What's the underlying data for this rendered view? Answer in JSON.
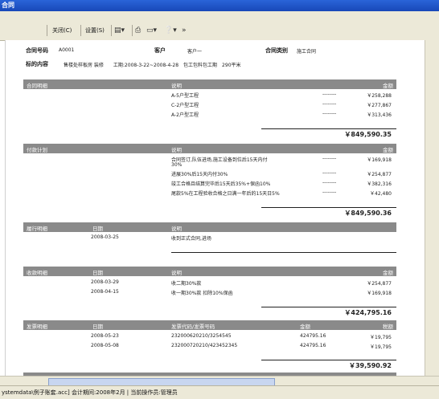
{
  "window": {
    "title": "合同"
  },
  "toolbar": {
    "close": "关闭(C)",
    "settings": "设置(S)"
  },
  "header": {
    "contract_no_label": "合同号码",
    "contract_no": "A0001",
    "customer_label": "客户",
    "customer": "客户一",
    "type_label": "合同类别",
    "type": "施工合同",
    "target_label": "标的内容",
    "target": "售楼处样板房 装修　　工期:2008-3-22~2008-4-28　包工包料包工期　290平米"
  },
  "contract_details": {
    "section": "合同明细",
    "desc_header": "说明",
    "amount_header": "金额",
    "rows": [
      {
        "desc": "A-5户型工程",
        "dash": "--------",
        "amount": "￥258,288"
      },
      {
        "desc": "C-2户型工程",
        "dash": "--------",
        "amount": "￥277,867"
      },
      {
        "desc": "A-2户型工程",
        "dash": "--------",
        "amount": "￥313,436"
      }
    ],
    "total": "￥849,590.35"
  },
  "payment_plan": {
    "section": "付款计划",
    "desc_header": "说明",
    "amount_header": "金额",
    "rows": [
      {
        "desc": "合同签订,队伍进场,施工设备到位后15天内付",
        "desc2": "30%",
        "dash": "--------",
        "amount": "￥169,918"
      },
      {
        "desc": "进展30%后15天内付30%",
        "dash": "--------",
        "amount": "￥254,877"
      },
      {
        "desc": "竣工合格且结算完毕后15天后35%+保函10%",
        "dash": "--------",
        "amount": "￥382,316"
      },
      {
        "desc": "尾款5%在工程验收合格之日满一年后的15天日5%",
        "dash": "--------",
        "amount": "￥42,480"
      }
    ],
    "total": "￥849,590.36"
  },
  "performance": {
    "section": "履行明细",
    "date_header": "日期",
    "desc_header": "说明",
    "rows": [
      {
        "date": "2008-03-25",
        "desc": "收到正式合同,进场"
      }
    ]
  },
  "receipts": {
    "section": "收款明细",
    "date_header": "日期",
    "desc_header": "说明",
    "amount_header": "金额",
    "rows": [
      {
        "date": "2008-03-29",
        "desc": "收二期30%款",
        "amount": "￥254,877"
      },
      {
        "date": "2008-04-15",
        "desc": "收一期30%款 扣除10%保函",
        "amount": "￥169,918"
      }
    ],
    "total": "￥424,795.16"
  },
  "invoices": {
    "section": "发票明细",
    "date_header": "日期",
    "code_header": "发票代码/发票号码",
    "amount_header": "金额",
    "tax_header": "税额",
    "rows": [
      {
        "date": "2008-05-23",
        "code": "232000620210/3254545",
        "amount": "424795.16",
        "tax": "￥19,795"
      },
      {
        "date": "2008-05-08",
        "code": "232000720210/423452345",
        "amount": "424795.16",
        "tax": "￥19,795"
      }
    ],
    "total": "￥39,590.92"
  },
  "statusbar": {
    "text": "ystemdata\\例子账套.acc] 会计期间:2008年2月 | 当前操作员:管理员"
  }
}
